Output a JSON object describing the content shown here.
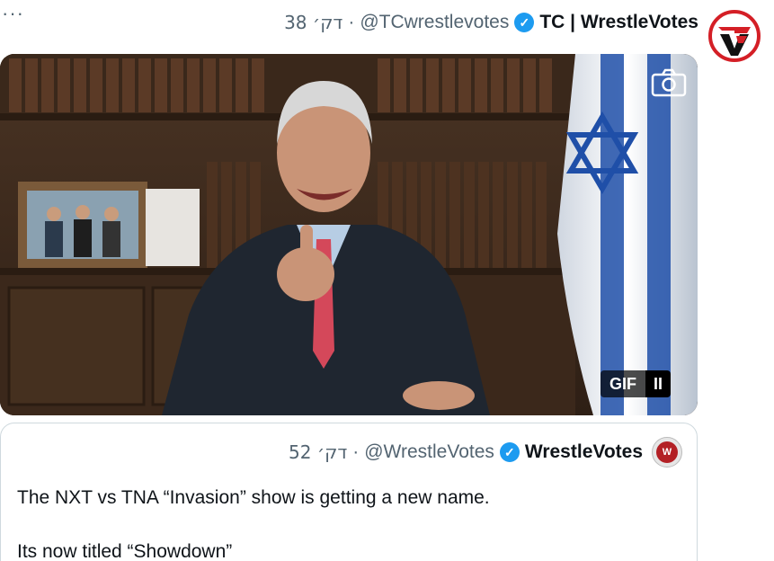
{
  "tweet": {
    "more_label": "···",
    "time": "38 דק׳",
    "separator": "·",
    "handle": "@TCwrestlevotes",
    "display_name": "TC | WrestleVotes",
    "verified_mark": "✓"
  },
  "media": {
    "badge_gif": "GIF",
    "badge_pause": "II",
    "camera_icon": "camera-icon"
  },
  "quoted": {
    "time": "52 דק׳",
    "separator": "·",
    "handle": "@WrestleVotes",
    "display_name": "WrestleVotes",
    "verified_mark": "✓",
    "avatar_text": "W",
    "text_line1": "The NXT vs TNA “Invasion” show is getting a new name.",
    "text_line2": "Its now titled “Showdown”"
  },
  "colors": {
    "accent": "#1d9bf0",
    "secondary_text": "#536471",
    "border": "#cfd9de",
    "brand_red": "#d41f26"
  }
}
